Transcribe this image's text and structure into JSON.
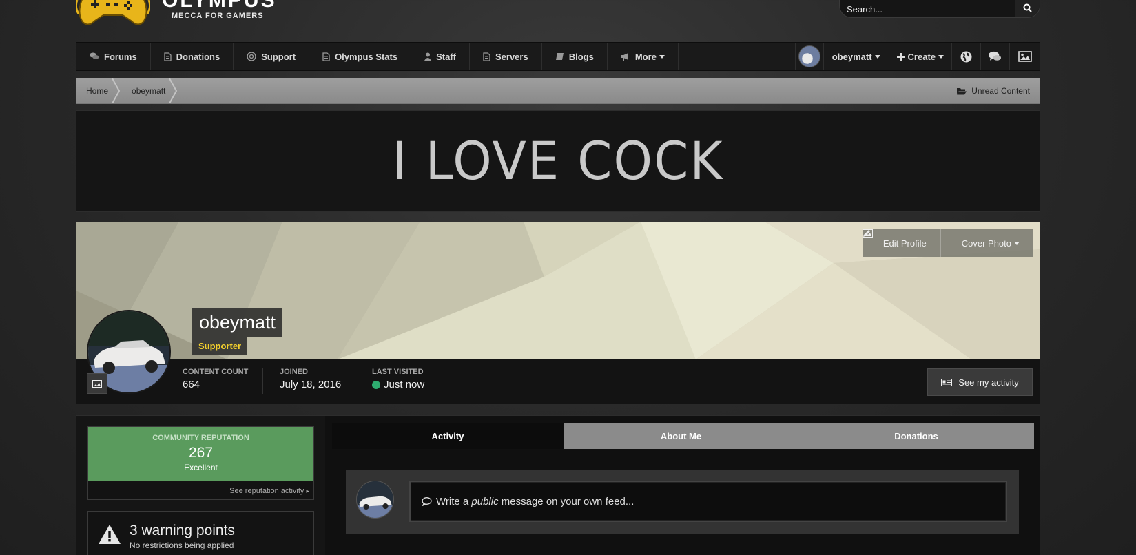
{
  "header": {
    "logo_title": "OLYMPUS",
    "logo_subtitle": "MECCA FOR GAMERS",
    "search_placeholder": "Search..."
  },
  "nav": {
    "items": [
      {
        "label": "Forums",
        "icon": "comments-icon"
      },
      {
        "label": "Donations",
        "icon": "document-icon"
      },
      {
        "label": "Support",
        "icon": "lifebuoy-icon"
      },
      {
        "label": "Olympus Stats",
        "icon": "document-icon"
      },
      {
        "label": "Staff",
        "icon": "user-icon"
      },
      {
        "label": "Servers",
        "icon": "document-icon"
      },
      {
        "label": "Blogs",
        "icon": "book-icon"
      },
      {
        "label": "More",
        "icon": "megaphone-icon"
      }
    ],
    "user_label": "obeymatt",
    "create_label": "Create"
  },
  "breadcrumb": {
    "items": [
      "Home",
      "obeymatt"
    ],
    "unread_label": "Unread Content"
  },
  "banner": {
    "text": "I LOVE COCK"
  },
  "profile": {
    "name": "obeymatt",
    "group": "Supporter",
    "edit_profile_label": "Edit Profile",
    "cover_photo_label": "Cover Photo",
    "stats": [
      {
        "label": "CONTENT COUNT",
        "value": "664"
      },
      {
        "label": "JOINED",
        "value": "July 18, 2016"
      },
      {
        "label": "LAST VISITED",
        "value": "Just now"
      }
    ],
    "activity_button_label": "See my activity",
    "online_color": "#2eab6f",
    "group_color": "#f3cf2d"
  },
  "reputation": {
    "label": "COMMUNITY REPUTATION",
    "value": "267",
    "level": "Excellent",
    "link_label": "See reputation activity",
    "color": "#5a9b5d"
  },
  "warnings": {
    "title": "3 warning points",
    "subtitle": "No restrictions being applied"
  },
  "tabs": {
    "items": [
      "Activity",
      "About Me",
      "Donations"
    ],
    "active": "Activity"
  },
  "composer": {
    "text_before": "Write a",
    "text_emphasis": "public",
    "text_after": "message on your own feed..."
  }
}
